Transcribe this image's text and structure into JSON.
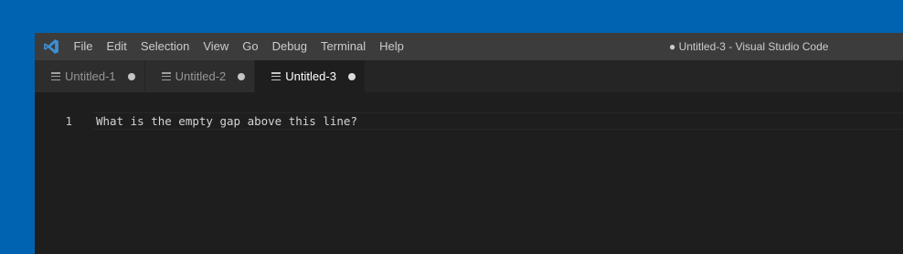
{
  "window": {
    "title": "● Untitled-3 - Visual Studio Code"
  },
  "app": {
    "icon": "vscode-logo-icon",
    "accent": "#3b8fd6"
  },
  "menubar": {
    "items": [
      "File",
      "Edit",
      "Selection",
      "View",
      "Go",
      "Debug",
      "Terminal",
      "Help"
    ]
  },
  "tabs": [
    {
      "label": "Untitled-1",
      "dirty": true,
      "active": false
    },
    {
      "label": "Untitled-2",
      "dirty": true,
      "active": false
    },
    {
      "label": "Untitled-3",
      "dirty": true,
      "active": true
    }
  ],
  "editor": {
    "lines": [
      {
        "number": "1",
        "text": "What is the empty gap above this line?"
      }
    ]
  },
  "colors": {
    "desktop": "#0063b1",
    "titlebar": "#3c3c3c",
    "tabbar": "#252526",
    "inactive_tab": "#2d2d2d",
    "editor": "#1e1e1e"
  }
}
